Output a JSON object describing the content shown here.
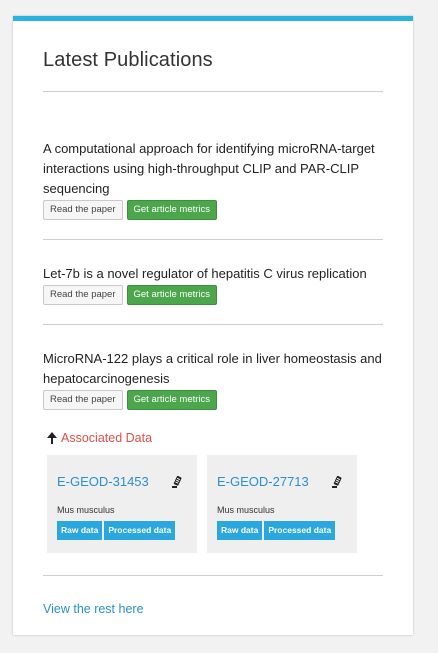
{
  "section": {
    "title": "Latest Publications",
    "view_rest": "View the rest here"
  },
  "publications": [
    {
      "title": "A computational approach for identifying microRNA-target interactions using high-throughput CLIP and PAR-CLIP sequencing",
      "read_label": "Read the paper",
      "metrics_label": "Get article metrics"
    },
    {
      "title": "Let-7b is a novel regulator of hepatitis C virus replication",
      "read_label": "Read the paper",
      "metrics_label": "Get article metrics"
    },
    {
      "title": "MicroRNA-122 plays a critical role in liver homeostasis and hepatocarcinogenesis",
      "read_label": "Read the paper",
      "metrics_label": "Get article metrics"
    }
  ],
  "associated": {
    "label": "Associated Data",
    "datasets": [
      {
        "id": "E-GEOD-31453",
        "species": "Mus musculus",
        "raw_label": "Raw data",
        "processed_label": "Processed data",
        "icon": "dna-sequencer-icon"
      },
      {
        "id": "E-GEOD-27713",
        "species": "Mus musculus",
        "raw_label": "Raw data",
        "processed_label": "Processed data",
        "icon": "dna-sequencer-icon"
      }
    ]
  },
  "colors": {
    "accent_top": "#29b4e0",
    "metrics_button": "#4ca64c",
    "data_button": "#29a7de",
    "link": "#2a8fd0",
    "associated_label": "#e0504a"
  }
}
